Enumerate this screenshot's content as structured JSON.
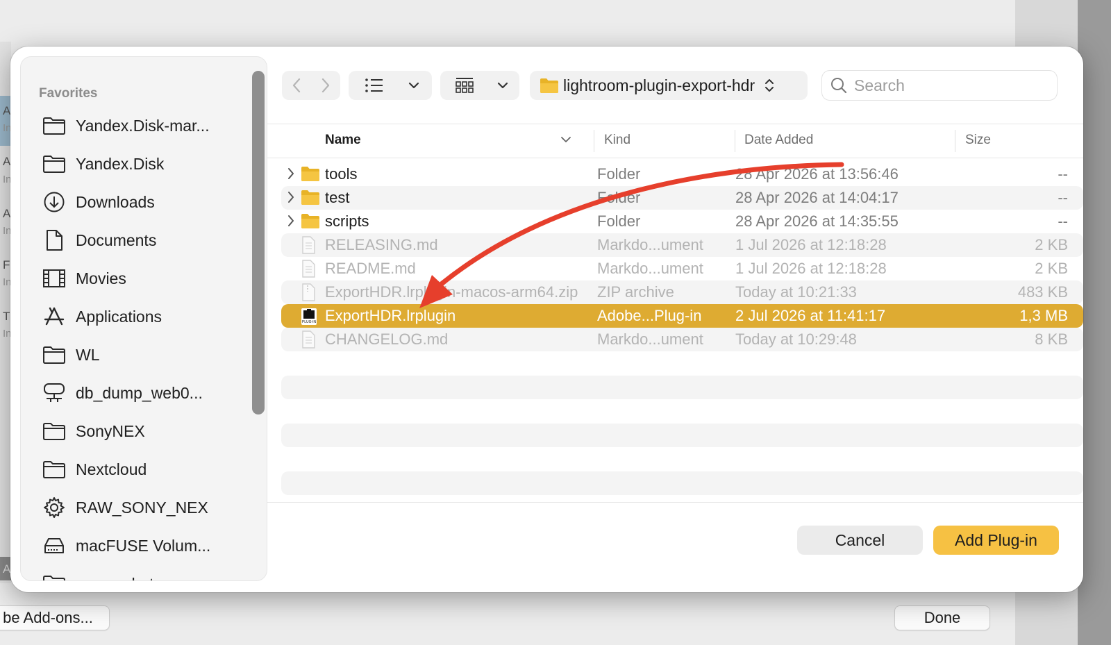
{
  "background": {
    "left_letters": [
      "A",
      "In",
      "A",
      "In",
      "A",
      "In",
      "F",
      "In",
      "T",
      "In",
      "A"
    ],
    "manage_addons_label": "be Add-ons...",
    "done_label": "Done"
  },
  "sidebar": {
    "heading": "Favorites",
    "items": [
      {
        "label": "Yandex.Disk-mar...",
        "icon": "folder-icon"
      },
      {
        "label": "Yandex.Disk",
        "icon": "folder-icon"
      },
      {
        "label": "Downloads",
        "icon": "download-icon"
      },
      {
        "label": "Documents",
        "icon": "document-icon"
      },
      {
        "label": "Movies",
        "icon": "film-icon"
      },
      {
        "label": "Applications",
        "icon": "applications-icon"
      },
      {
        "label": "WL",
        "icon": "folder-icon"
      },
      {
        "label": "db_dump_web0...",
        "icon": "network-drive-icon"
      },
      {
        "label": "SonyNEX",
        "icon": "folder-icon"
      },
      {
        "label": "Nextcloud",
        "icon": "folder-icon"
      },
      {
        "label": "RAW_SONY_NEX",
        "icon": "gear-icon"
      },
      {
        "label": "macFUSE Volum...",
        "icon": "drive-icon"
      },
      {
        "label": "screenshots",
        "icon": "folder-icon"
      }
    ]
  },
  "toolbar": {
    "path_label": "lightroom-plugin-export-hdr",
    "search_placeholder": "Search"
  },
  "columns": {
    "name": "Name",
    "kind": "Kind",
    "date": "Date Added",
    "size": "Size"
  },
  "rows": [
    {
      "name": "tools",
      "kind": "Folder",
      "date": "28 Apr 2026 at 13:56:46",
      "size": "--"
    },
    {
      "name": "test",
      "kind": "Folder",
      "date": "28 Apr 2026 at 14:04:17",
      "size": "--"
    },
    {
      "name": "scripts",
      "kind": "Folder",
      "date": "28 Apr 2026 at 14:35:55",
      "size": "--"
    },
    {
      "name": "RELEASING.md",
      "kind": "Markdo...ument",
      "date": "1 Jul 2026 at 12:18:28",
      "size": "2 KB"
    },
    {
      "name": "README.md",
      "kind": "Markdo...ument",
      "date": "1 Jul 2026 at 12:18:28",
      "size": "2 KB"
    },
    {
      "name": "ExportHDR.lrplugin-macos-arm64.zip",
      "kind": "ZIP archive",
      "date": "Today at 10:21:33",
      "size": "483 KB"
    },
    {
      "name": "ExportHDR.lrplugin",
      "kind": "Adobe...Plug-in",
      "date": "2 Jul 2026 at 11:41:17",
      "size": "1,3 MB",
      "icon_text": "PLUG-IN"
    },
    {
      "name": "CHANGELOG.md",
      "kind": "Markdo...ument",
      "date": "Today at 10:29:48",
      "size": "8 KB"
    }
  ],
  "buttons": {
    "cancel": "Cancel",
    "add": "Add Plug-in"
  },
  "colors": {
    "accent": "#f6c143",
    "selection": "#deab32",
    "annotation_arrow": "#e63f2c",
    "folder": "#f5c542"
  }
}
